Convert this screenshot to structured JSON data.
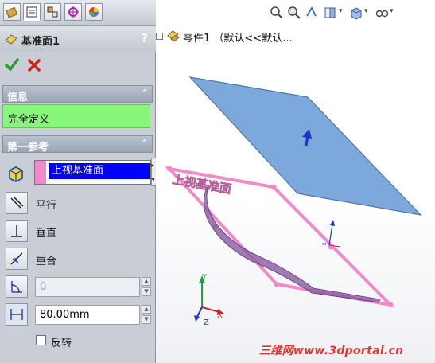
{
  "property_manager": {
    "tabs": [
      {
        "icon": "feature-manager-icon"
      },
      {
        "icon": "property-manager-icon"
      },
      {
        "icon": "configuration-manager-icon"
      },
      {
        "icon": "dimxpert-icon"
      },
      {
        "icon": "display-manager-icon"
      }
    ],
    "title": "基准面1",
    "help": "?",
    "info_group": {
      "label": "信息",
      "message": "完全定义"
    },
    "first_reference": {
      "label": "第一参考",
      "selected": "上视基准面",
      "options": [
        "平行",
        "垂直",
        "重合"
      ],
      "angle_value": "0",
      "distance_value": "80.00mm",
      "flip_label": "反转",
      "flip_checked": false
    }
  },
  "tree": {
    "expander": "⊞",
    "text": "零件1 （默认<<默认..."
  },
  "viewport": {
    "plane_preview_color": "#6f9fd8",
    "reference_plane_color": "#ef8bc8",
    "reference_plane_label": "上视基准面"
  },
  "triad": {
    "x": "X",
    "y": "Y",
    "z": "Z"
  },
  "watermark": "三维网www.3dportal.cn",
  "colors": {
    "ok": "#2a9a2a",
    "cancel": "#d21f1f",
    "status_ok": "#86f77a",
    "selection": "#0000ff"
  }
}
